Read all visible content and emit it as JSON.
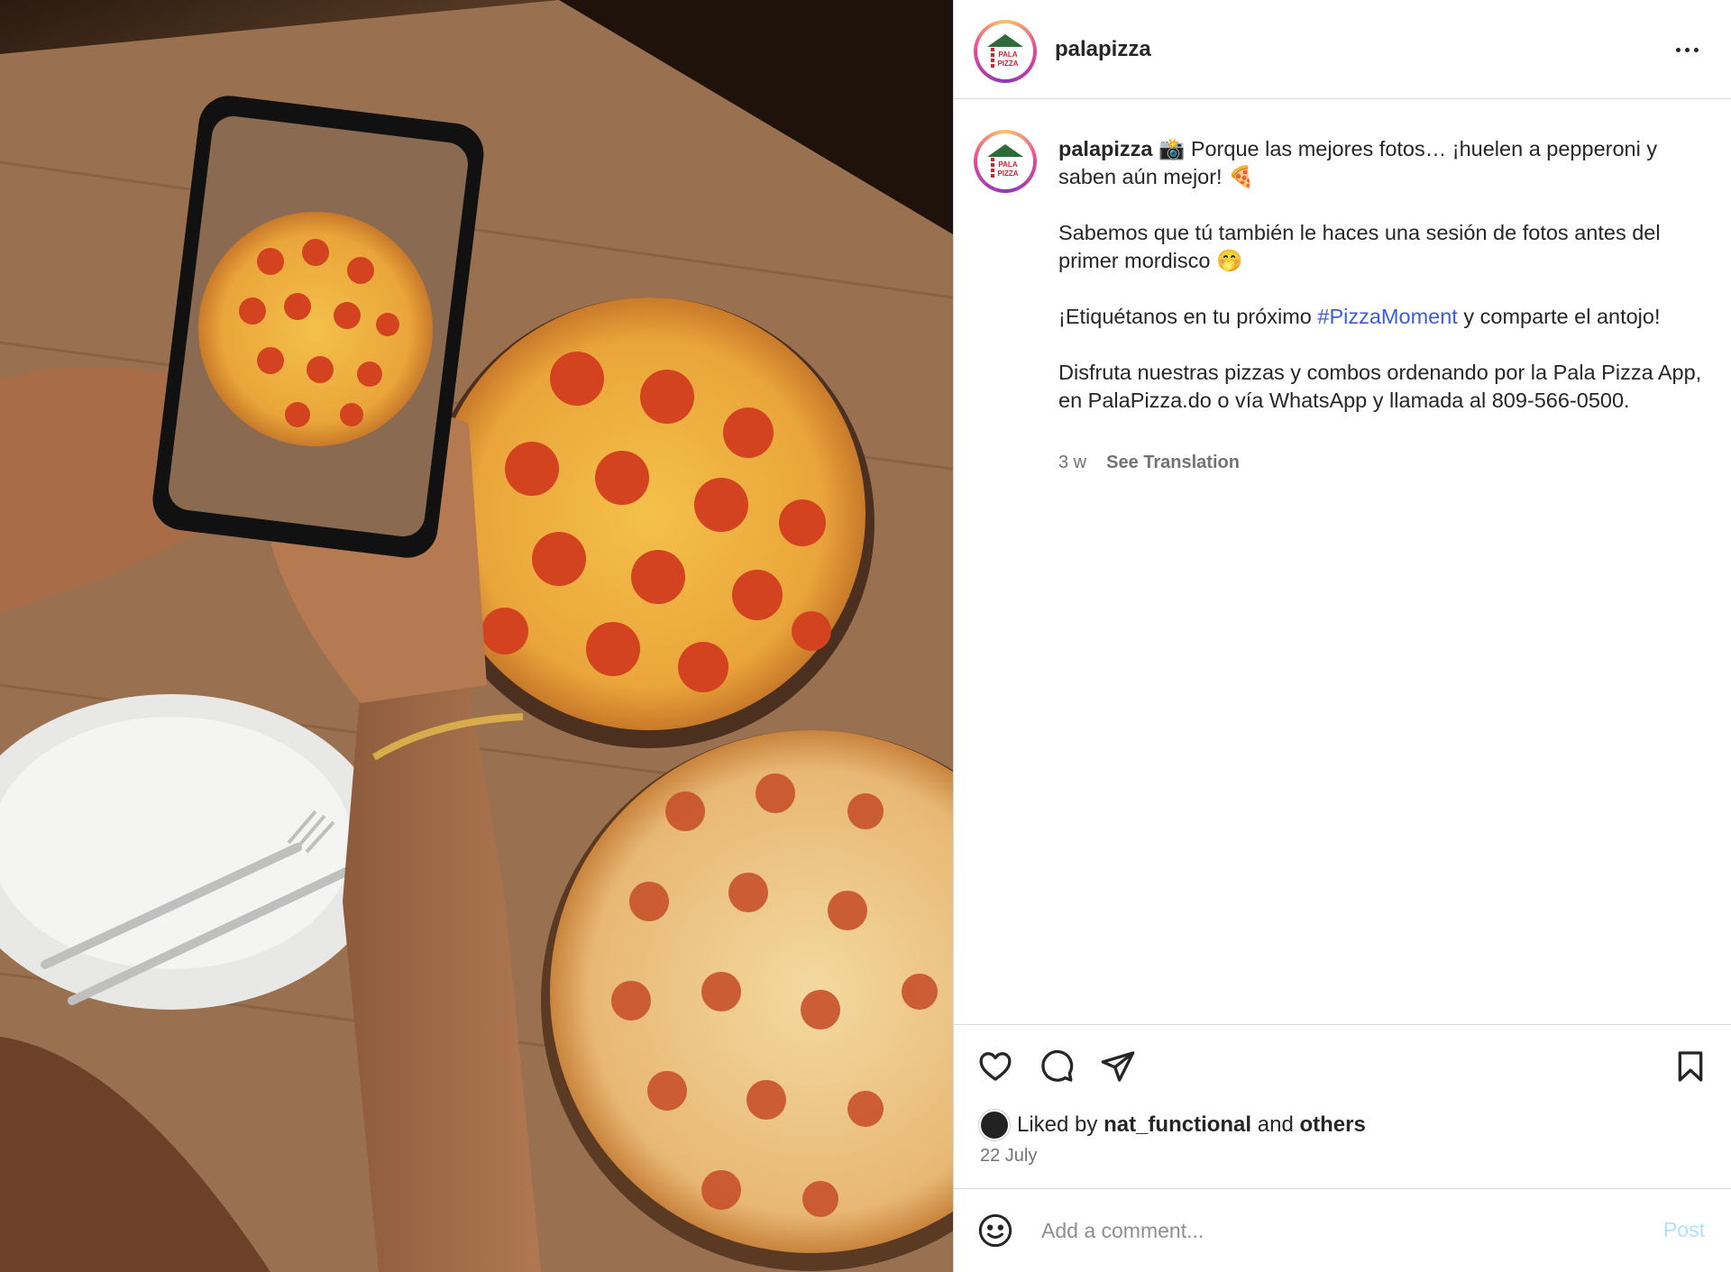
{
  "post": {
    "account": "palapizza",
    "logo_text": "PALA PIZZA",
    "caption": {
      "username": "palapizza",
      "line1_emoji": "📸",
      "line1_text": "Porque las mejores fotos… ¡huelen a pepperoni y saben aún mejor!",
      "line1_end_emoji": "🍕",
      "para2": "Sabemos que tú también le haces una sesión de fotos antes del primer mordisco",
      "para2_emoji": "🤭",
      "para3_before": "¡Etiquétanos en tu próximo",
      "hashtag": "#PizzaMoment",
      "para3_after": "y comparte el antojo!",
      "para4": "Disfruta nuestras pizzas y combos ordenando por la Pala Pizza App, en PalaPizza.do o vía WhatsApp y llamada al 809-566-0500."
    },
    "age": "3 w",
    "see_translation": "See Translation",
    "liked_by_prefix": "Liked by",
    "liked_by_user": "nat_functional",
    "liked_by_and": "and",
    "liked_by_others": "others",
    "date": "22 July",
    "comment_placeholder": "Add a comment...",
    "post_label": "Post"
  },
  "icons": {
    "like": "heart-icon",
    "comment": "comment-icon",
    "share": "send-icon",
    "save": "bookmark-icon",
    "emoji": "smiley-icon",
    "more": "more-options-icon"
  },
  "colors": {
    "hashtag": "#3b5bdb",
    "post_button_disabled": "#b2dffc",
    "border": "#dbdbdb",
    "muted_text": "#737373"
  }
}
